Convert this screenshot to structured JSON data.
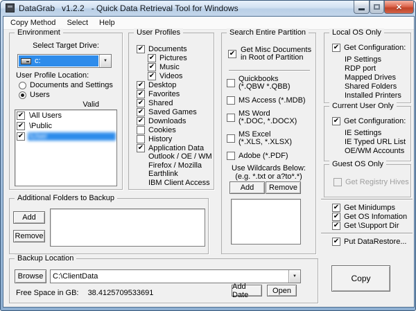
{
  "icons": {
    "check": "✔",
    "dropdown": "▼",
    "close": "✕",
    "minimize": "minimize-bar",
    "maximize": "maximize-square",
    "drive": "drive-icon"
  },
  "colors": {
    "selection_blue": "#2e8ceb",
    "close_red": "#c14328",
    "client_bg": "#f0f0f0",
    "titlebar_blue": "#c3d6ea"
  },
  "window": {
    "title": "DataGrab   v1.2.2   - Quick Data Retrieval Tool for Windows"
  },
  "menu": {
    "items": [
      "Copy Method",
      "Select",
      "Help"
    ]
  },
  "environment": {
    "title": "Environment",
    "drive_label": "Select Target Drive:",
    "drive_value": "c:",
    "profile_location_label": "User Profile Location:",
    "radio_options": [
      {
        "label": "Documents and Settings",
        "selected": false
      },
      {
        "label": "Users",
        "selected": true
      }
    ],
    "valid_label": "Valid",
    "profiles": [
      {
        "label": "\\All Users",
        "checked": true,
        "selected": false,
        "redacted": false
      },
      {
        "label": "\\Public",
        "checked": true,
        "selected": false,
        "redacted": false
      },
      {
        "label": "\\User",
        "checked": true,
        "selected": true,
        "redacted": true
      }
    ]
  },
  "additional_folders": {
    "title": "Additional Folders to Backup",
    "add_label": "Add",
    "remove_label": "Remove"
  },
  "user_profiles": {
    "title": "User Profiles",
    "items": [
      {
        "label": "Documents",
        "checked": true,
        "indent": 0
      },
      {
        "label": "Pictures",
        "checked": true,
        "indent": 1
      },
      {
        "label": "Music",
        "checked": true,
        "indent": 1
      },
      {
        "label": "Videos",
        "checked": true,
        "indent": 1
      },
      {
        "label": "Desktop",
        "checked": true,
        "indent": 0
      },
      {
        "label": "Favorites",
        "checked": true,
        "indent": 0
      },
      {
        "label": "Shared",
        "checked": true,
        "indent": 0
      },
      {
        "label": "Saved Games",
        "checked": true,
        "indent": 0
      },
      {
        "label": "Downloads",
        "checked": true,
        "indent": 0
      },
      {
        "label": "Cookies",
        "checked": false,
        "indent": 0
      },
      {
        "label": "History",
        "checked": false,
        "indent": 0
      },
      {
        "label": "Application Data",
        "checked": true,
        "indent": 0
      }
    ],
    "app_data_subitems": [
      "Outlook / OE / WM",
      "Firefox / Mozilla",
      "Earthlink",
      "IBM Client Access"
    ]
  },
  "search_partition": {
    "title": "Search Entire Partition",
    "misc_line1": "Get Misc Documents",
    "misc_line2": "in Root of Partition",
    "misc_checked": true,
    "filetypes": [
      {
        "label": "Quickbooks",
        "sub": "(*.QBW *.QBB)",
        "checked": false
      },
      {
        "label": "MS Access (*.MDB)",
        "sub": "",
        "checked": false
      },
      {
        "label": "MS Word",
        "sub": "(*.DOC, *.DOCX)",
        "checked": false
      },
      {
        "label": "MS Excel",
        "sub": "(*.XLS, *.XLSX)",
        "checked": false
      },
      {
        "label": "Adobe  (*.PDF)",
        "sub": "",
        "checked": false
      }
    ],
    "hint1": "Use Wildcards Below:",
    "hint2": "(e.g. *.txt or a?to*.*)",
    "add_label": "Add",
    "remove_label": "Remove"
  },
  "local_os": {
    "title": "Local OS Only",
    "checkbox_label": "Get Configuration:",
    "checked": true,
    "items": [
      "IP Settings",
      "RDP port",
      "Mapped Drives",
      "Shared Folders",
      "Installed Printers"
    ]
  },
  "current_user": {
    "title": "Current User Only",
    "checkbox_label": "Get Configuration:",
    "checked": true,
    "items": [
      "IE Settings",
      "IE Typed URL List",
      "OE/WM Accounts"
    ]
  },
  "guest_os": {
    "title": "Guest OS Only",
    "checkbox_label": "Get Registry Hives",
    "checked": false,
    "disabled": true
  },
  "extra_options": [
    {
      "label": "Get Minidumps",
      "checked": true
    },
    {
      "label": "Get OS Infomation",
      "checked": true
    },
    {
      "label": "Get \\Support Dir",
      "checked": true
    }
  ],
  "put_datarestore": {
    "label": "Put DataRestore...",
    "checked": true
  },
  "backup_location": {
    "title": "Backup Location",
    "browse_label": "Browse",
    "path_value": "C:\\ClientData",
    "free_space_label": "Free Space in GB:",
    "free_space_value": "38.4125709533691",
    "add_date_label": "Add Date",
    "open_label": "Open"
  },
  "copy_button_label": "Copy"
}
